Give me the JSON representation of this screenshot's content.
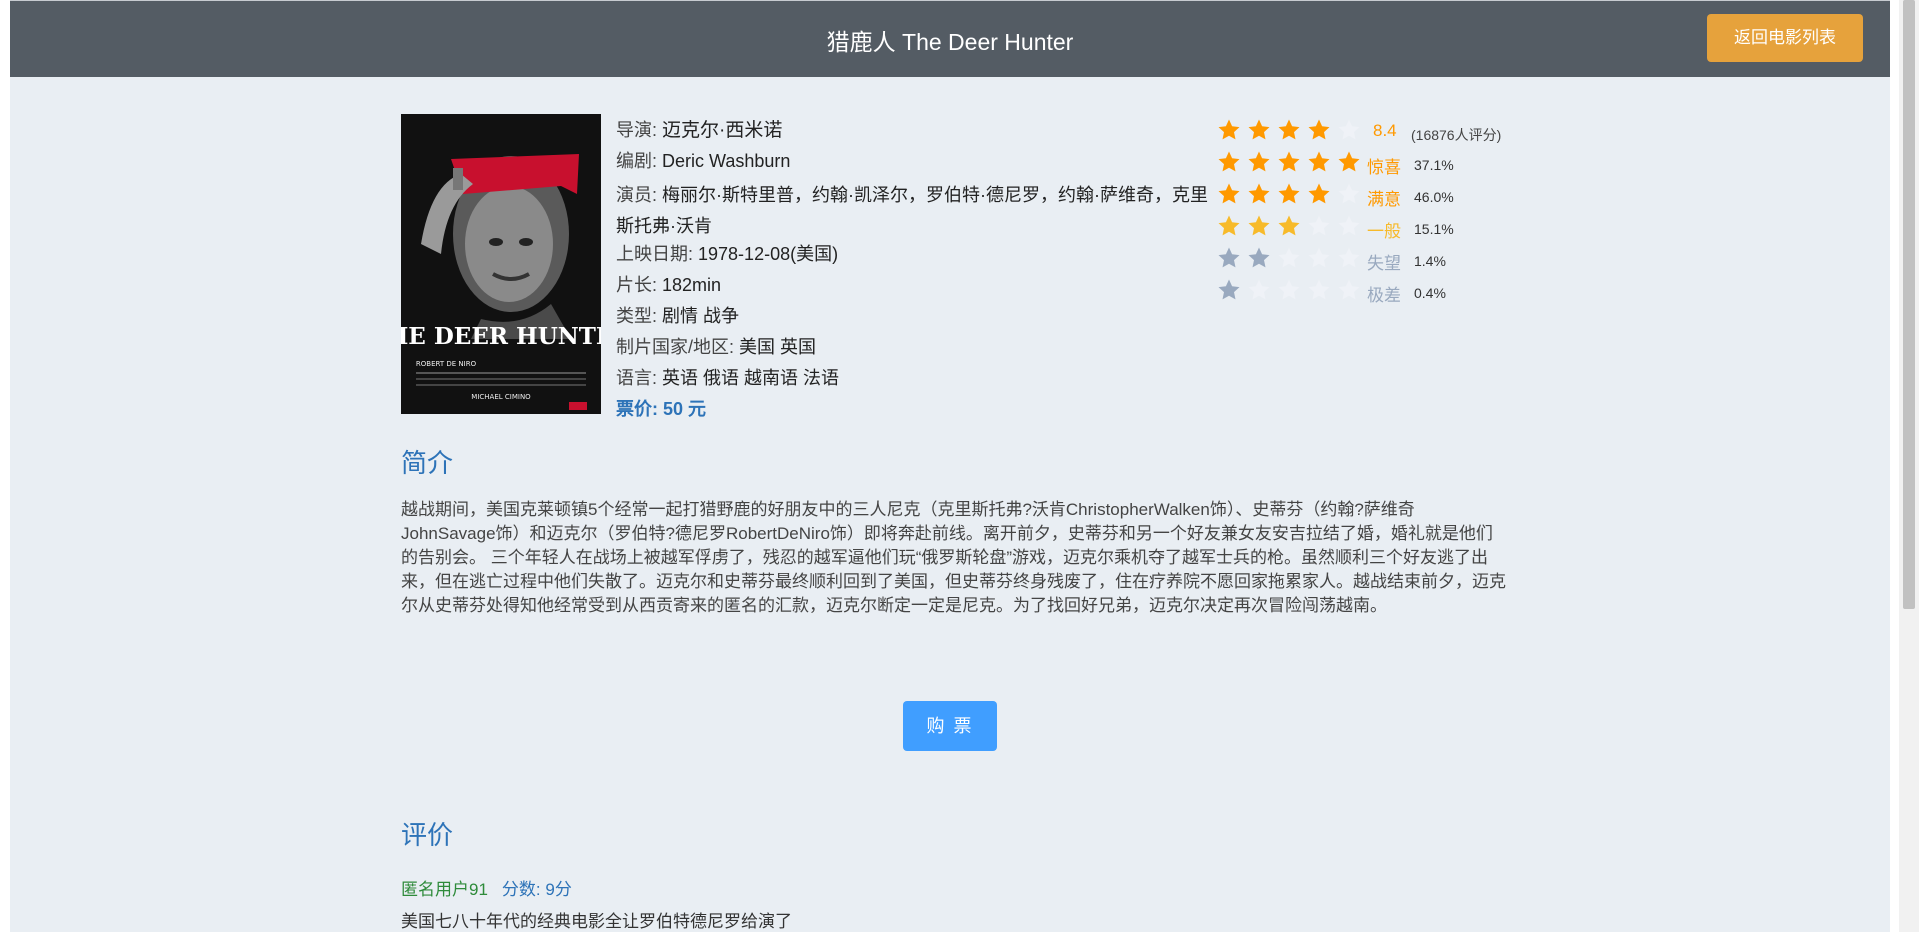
{
  "header": {
    "title": "猎鹿人 The Deer Hunter",
    "back_button": "返回电影列表"
  },
  "poster": {
    "title_text": "THE DEER HUNTER",
    "cast_line": "ROBERT DE NIRO",
    "director_line": "MICHAEL CIMINO"
  },
  "movie": {
    "director_label": "导演: ",
    "director": "迈克尔·西米诺",
    "writer_label": "编剧: ",
    "writer": "Deric Washburn",
    "cast_label": "演员: ",
    "cast": "梅丽尔·斯特里普，约翰·凯泽尔，罗伯特·德尼罗，约翰·萨维奇，克里斯托弗·沃肯",
    "release_label": "上映日期: ",
    "release": "1978-12-08(美国)",
    "runtime_label": "片长: ",
    "runtime": "182min",
    "genre_label": "类型: ",
    "genre": "剧情 战争",
    "country_label": "制片国家/地区: ",
    "country": "美国 英国",
    "language_label": "语言: ",
    "language": "英语 俄语 越南语 法语",
    "price_label": "票价: ",
    "price": "50 元"
  },
  "rating": {
    "average": "8.4",
    "count_text": "(16876人评分)",
    "average_stars": 4,
    "colors": {
      "gold": "#f7ba2a",
      "orange": "#ff9900",
      "blue_gray": "#99a9bf",
      "empty": "#eff2f7"
    },
    "breakdown": [
      {
        "label": "惊喜",
        "percent": "37.1%",
        "stars": 5
      },
      {
        "label": "满意",
        "percent": "46.0%",
        "stars": 4
      },
      {
        "label": "一般",
        "percent": "15.1%",
        "stars": 3
      },
      {
        "label": "失望",
        "percent": "1.4%",
        "stars": 2
      },
      {
        "label": "极差",
        "percent": "0.4%",
        "stars": 1
      }
    ]
  },
  "intro": {
    "title": "简介",
    "text": "越战期间，美国克莱顿镇5个经常一起打猎野鹿的好朋友中的三人尼克（克里斯托弗?沃肯ChristopherWalken饰）、史蒂芬（约翰?萨维奇JohnSavage饰）和迈克尔（罗伯特?德尼罗RobertDeNiro饰）即将奔赴前线。离开前夕，史蒂芬和另一个好友兼女友安吉拉结了婚，婚礼就是他们的告别会。 三个年轻人在战场上被越军俘虏了，残忍的越军逼他们玩“俄罗斯轮盘”游戏，迈克尔乘机夺了越军士兵的枪。虽然顺利三个好友逃了出来，但在逃亡过程中他们失散了。迈克尔和史蒂芬最终顺利回到了美国，但史蒂芬终身残废了，住在疗养院不愿回家拖累家人。越战结束前夕，迈克尔从史蒂芬处得知他经常受到从西贡寄来的匿名的汇款，迈克尔断定一定是尼克。为了找回好兄弟，迈克尔决定再次冒险闯荡越南。"
  },
  "buy_button": "购 票",
  "reviews": {
    "title": "评价",
    "items": [
      {
        "user": "匿名用户91",
        "score": "分数: 9分",
        "text": "美国七八十年代的经典电影全让罗伯特德尼罗给演了"
      }
    ]
  }
}
